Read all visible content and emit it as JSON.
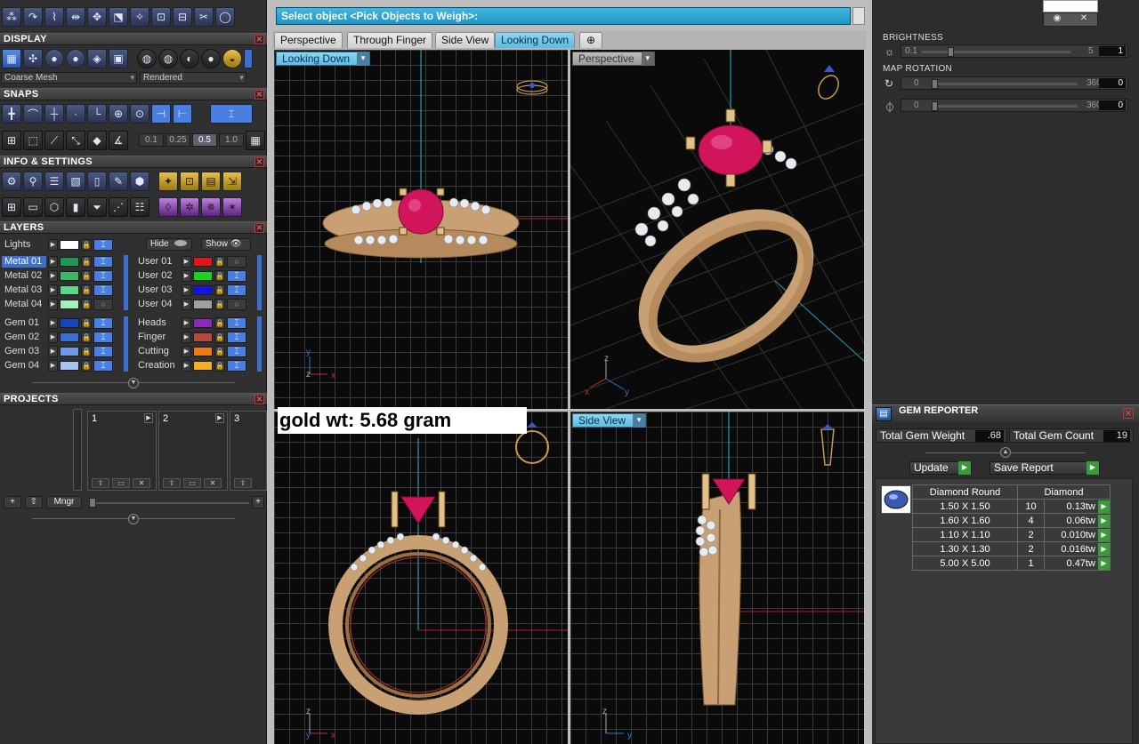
{
  "command_prompt": "Select object <Pick Objects to Weigh>:",
  "tabs": [
    "Perspective",
    "Through Finger",
    "Side View",
    "Looking Down"
  ],
  "active_tab": "Looking Down",
  "viewports": {
    "top_left": "Looking Down",
    "top_right": "Perspective",
    "bottom_right": "Side View"
  },
  "gold_weight": "gold wt: 5.68 gram",
  "left_panel": {
    "display": {
      "title": "DISPLAY",
      "mesh_mode": "Coarse Mesh",
      "render_mode": "Rendered"
    },
    "snaps": {
      "title": "SNAPS",
      "values": [
        "0.1",
        "0.25",
        "0.5",
        "1.0"
      ],
      "active_value": "0.5"
    },
    "info": {
      "title": "INFO & SETTINGS"
    },
    "layers": {
      "title": "LAYERS",
      "lights": "Lights",
      "hide": "Hide",
      "show": "Show",
      "left_col": [
        {
          "name": "Metal 01",
          "color": "#1a9a55",
          "selected": true
        },
        {
          "name": "Metal 02",
          "color": "#3ab86a"
        },
        {
          "name": "Metal 03",
          "color": "#5ed888"
        },
        {
          "name": "Metal 04",
          "color": "#a4f0b8"
        },
        {
          "name": "Gem 01",
          "color": "#1744b8"
        },
        {
          "name": "Gem 02",
          "color": "#3a6fd6"
        },
        {
          "name": "Gem 03",
          "color": "#6f9ae6"
        },
        {
          "name": "Gem 04",
          "color": "#a9c4f0"
        }
      ],
      "right_col": [
        {
          "name": "User 01",
          "color": "#e01515"
        },
        {
          "name": "User 02",
          "color": "#1fd01f"
        },
        {
          "name": "User 03",
          "color": "#1515e0"
        },
        {
          "name": "User 04",
          "color": "#a0a0a0"
        },
        {
          "name": "Heads",
          "color": "#8a2ab8"
        },
        {
          "name": "Finger",
          "color": "#b84a3a"
        },
        {
          "name": "Cutting",
          "color": "#f07a12"
        },
        {
          "name": "Creation",
          "color": "#f5b020"
        }
      ]
    },
    "projects": {
      "title": "PROJECTS",
      "slots": [
        "1",
        "2",
        "3"
      ],
      "mngr": "Mngr"
    }
  },
  "right_panel": {
    "brightness": {
      "label": "BRIGHTNESS",
      "min": "0.1",
      "max": "5",
      "value": "1"
    },
    "map_rotation": {
      "label": "MAP ROTATION",
      "rows": [
        {
          "min": "0",
          "max": "360",
          "value": "0"
        },
        {
          "min": "0",
          "max": "360",
          "value": "0"
        }
      ]
    }
  },
  "gem_reporter": {
    "title": "GEM REPORTER",
    "total_weight_label": "Total Gem Weight",
    "total_weight": ".68",
    "total_count_label": "Total Gem Count",
    "total_count": "19",
    "update": "Update",
    "save_report": "Save Report",
    "table_header": [
      "Diamond Round",
      "Diamond"
    ],
    "rows": [
      {
        "size": "1.50 X 1.50",
        "count": "10",
        "weight": "0.13tw"
      },
      {
        "size": "1.60 X 1.60",
        "count": "4",
        "weight": "0.06tw"
      },
      {
        "size": "1.10 X 1.10",
        "count": "2",
        "weight": "0.010tw"
      },
      {
        "size": "1.30 X 1.30",
        "count": "2",
        "weight": "0.016tw"
      },
      {
        "size": "5.00 X 5.00",
        "count": "1",
        "weight": "0.47tw"
      }
    ]
  }
}
